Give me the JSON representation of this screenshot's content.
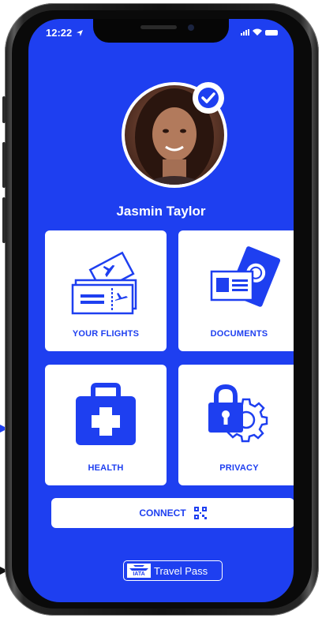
{
  "status_bar": {
    "time": "12:22"
  },
  "profile": {
    "name": "Jasmin Taylor",
    "verified": true
  },
  "tiles": [
    {
      "label": "YOUR FLIGHTS",
      "icon": "flight-ticket-icon"
    },
    {
      "label": "DOCUMENTS",
      "icon": "passport-documents-icon"
    },
    {
      "label": "HEALTH",
      "icon": "medical-kit-icon"
    },
    {
      "label": "PRIVACY",
      "icon": "lock-gear-icon"
    }
  ],
  "connect": {
    "label": "CONNECT",
    "icon": "qr-code-icon"
  },
  "brand": {
    "logo_text": "IATA",
    "name": "Travel Pass"
  },
  "colors": {
    "primary": "#1e3ff0",
    "surface": "#ffffff"
  }
}
